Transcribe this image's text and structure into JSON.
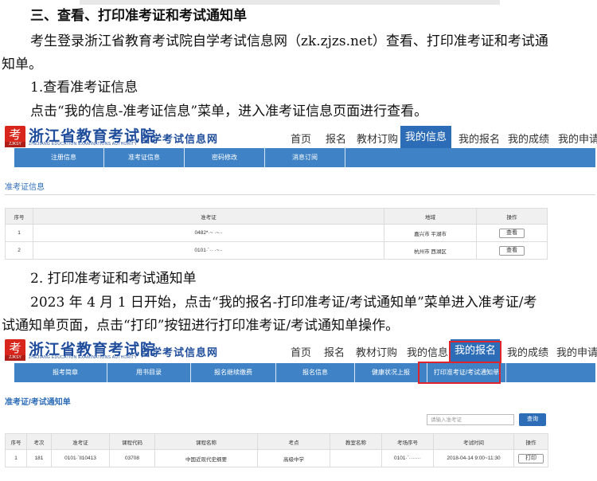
{
  "section_heading": "三、查看、打印准考证和考试通知单",
  "intro_line1": "考生登录浙江省教育考试院自学考试信息网（zk.zjzs.net）查看、打印准考证和考试通",
  "intro_line2": "知单。",
  "step1_heading": "1.查看准考证信息",
  "step1_text": "点击“我的信息-准考证信息”菜单，进入准考证信息页面进行查看。",
  "step2_heading": "2. 打印准考证和考试通知单",
  "step2_text1": "2023 年 4 月 1 日开始，点击“我的报名-打印准考证/考试通知单”菜单进入准考证/考",
  "step2_text2": "试通知单页面，点击“打印”按钮进行打印准考证/考试通知单操作。",
  "site": {
    "logo_char": "考",
    "logo_sub": "ZJKSY",
    "name": "浙江省教育考试院",
    "name_en": "ZHEJIANG EDUCATION EXAMINATIONS AUTHORITY",
    "slogan": "自学考试信息网",
    "nav": [
      "首页",
      "报名",
      "教材订购",
      "我的信息",
      "我的报名",
      "我的成绩",
      "我的申请"
    ]
  },
  "shot1": {
    "active_nav": "我的信息",
    "subnav": [
      "注册信息",
      "准考证信息",
      "密码修改",
      "消息订阅"
    ],
    "page_title": "准考证信息",
    "columns": [
      "序号",
      "准考证",
      "地域",
      "操作"
    ],
    "rows": [
      {
        "no": "1",
        "ticket": "0482*·~ ·~··",
        "region": "嘉兴市 平湖市",
        "action": "查看"
      },
      {
        "no": "2",
        "ticket": "0101·´·· ·~··",
        "region": "杭州市 西湖区",
        "action": "查看"
      }
    ]
  },
  "shot2": {
    "active_nav": "我的报名",
    "subnav": [
      "报考简章",
      "用书目录",
      "报名继续缴费",
      "报名信息",
      "健康状况上报",
      "打印准考证/考试通知单"
    ],
    "page_title": "准考证/考试通知单",
    "search_placeholder": "请输入准考证",
    "search_button": "查询",
    "columns": [
      "序号",
      "考次",
      "准考证",
      "课程代码",
      "课程名称",
      "考点",
      "教室名称",
      "考场序号",
      "考试时间",
      "操作"
    ],
    "rows": [
      {
        "no": "1",
        "session": "181",
        "ticket": "0101·´ll10413",
        "code": "03708",
        "course": "中国近现代史纲要",
        "site": "高级中学",
        "room": "",
        "seat": "0101·´·······",
        "time": "2018-04-14 9:00~11:30",
        "action": "打印"
      }
    ]
  }
}
